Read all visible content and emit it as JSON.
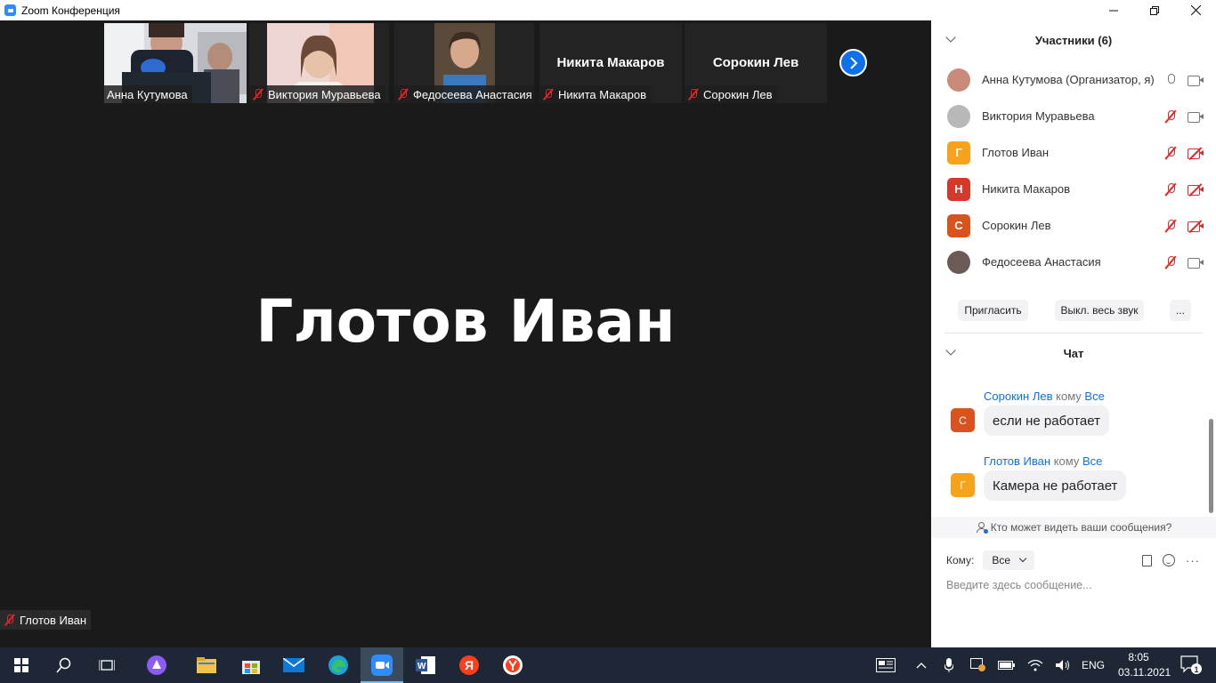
{
  "window": {
    "title": "Zoom Конференция"
  },
  "thumbnails": [
    {
      "name": "Анна Кутумова",
      "muted": false,
      "video": true
    },
    {
      "name": "Виктория Муравьева",
      "muted": true,
      "video": true
    },
    {
      "name": "Федосеева Анастасия",
      "muted": true,
      "video": true
    },
    {
      "name": "Никита Макаров",
      "muted": true,
      "video": false
    },
    {
      "name": "Сорокин Лев",
      "muted": true,
      "video": false
    }
  ],
  "active_speaker": {
    "name": "Глотов Иван",
    "label": "Глотов Иван"
  },
  "participants_panel": {
    "title": "Участники (6)",
    "items": [
      {
        "name": "Анна Кутумова (Организатор, я)",
        "initial": "",
        "color": "#c98a7a",
        "mic": "on",
        "cam": "on"
      },
      {
        "name": "Виктория Муравьева",
        "initial": "",
        "color": "#b8b8b8",
        "mic": "off",
        "cam": "on"
      },
      {
        "name": "Глотов Иван",
        "initial": "Г",
        "color": "#f7a21b",
        "mic": "off",
        "cam": "off"
      },
      {
        "name": "Никита Макаров",
        "initial": "Н",
        "color": "#d33a2c",
        "mic": "off",
        "cam": "off"
      },
      {
        "name": "Сорокин Лев",
        "initial": "С",
        "color": "#d9531e",
        "mic": "off",
        "cam": "off"
      },
      {
        "name": "Федосеева Анастасия",
        "initial": "",
        "color": "#6b5a55",
        "mic": "off",
        "cam": "on"
      }
    ],
    "buttons": {
      "invite": "Пригласить",
      "mute_all": "Выкл. весь звук",
      "more": "..."
    }
  },
  "chat": {
    "title": "Чат",
    "messages": [
      {
        "sender": "Сорокин Лев",
        "to_word": "кому",
        "target": "Все",
        "initial": "С",
        "color": "#d9531e",
        "text": "если не работает"
      },
      {
        "sender": "Глотов Иван",
        "to_word": "кому",
        "target": "Все",
        "initial": "Г",
        "color": "#f7a21b",
        "text": "Камера не работает"
      }
    ],
    "visibility_note": "Кто может видеть ваши сообщения?",
    "to_label": "Кому:",
    "to_value": "Все",
    "input_placeholder": "Введите здесь сообщение...",
    "more": "···"
  },
  "taskbar": {
    "lang": "ENG",
    "time": "8:05",
    "date": "03.11.2021",
    "notifications": "1"
  }
}
